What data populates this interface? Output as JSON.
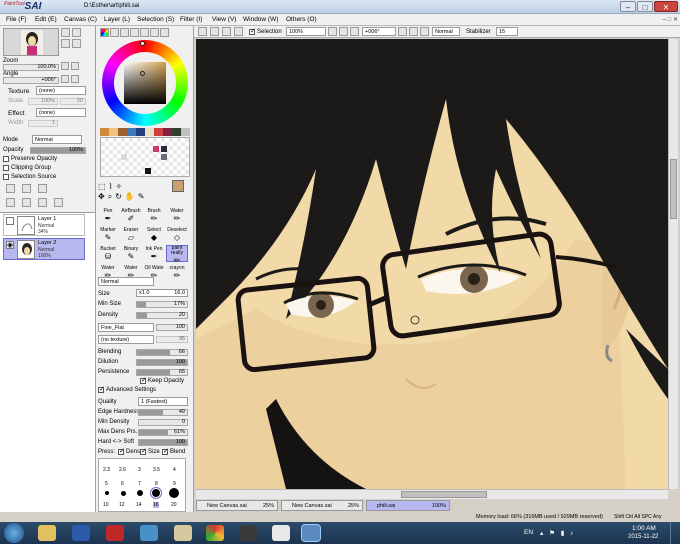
{
  "app": {
    "logo_main": "SAI",
    "logo_small": "PaintTool",
    "document_title": "D:\\Esther\\art\\phili.sai"
  },
  "menu": [
    {
      "label": "File (F)"
    },
    {
      "label": "Edit (E)"
    },
    {
      "label": "Canvas (C)"
    },
    {
      "label": "Layer (L)"
    },
    {
      "label": "Selection (S)"
    },
    {
      "label": "Filter (I)"
    },
    {
      "label": "View (V)"
    },
    {
      "label": "Window (W)"
    },
    {
      "label": "Others (O)"
    }
  ],
  "navigator": {
    "zoom_label": "Zoom",
    "zoom_value": "100.0%",
    "angle_label": "Angle",
    "angle_value": "+006°"
  },
  "paper": {
    "texture_label": "Texture",
    "texture_value": "(none)",
    "scale_label": "Scale",
    "scale_value": "100%",
    "strength_value": "20",
    "effect_label": "Effect",
    "effect_value": "(none)",
    "width_label": "Width",
    "width_value": "1"
  },
  "layer_props": {
    "mode_label": "Mode",
    "mode_value": "Normal",
    "opacity_label": "Opacity",
    "opacity_value": "100%",
    "opacity_fraction": 1.0,
    "preserve_opacity": "Preserve Opacity",
    "clipping_group": "Clipping Group",
    "selection_source": "Selection Source"
  },
  "layers": [
    {
      "name": "Layer 1",
      "mode": "Normal",
      "opacity": "34%",
      "selected": false
    },
    {
      "name": "Layer 2",
      "mode": "Normal",
      "opacity": "100%",
      "selected": true
    }
  ],
  "brushes": [
    {
      "label": "Pen"
    },
    {
      "label": "AirBrush"
    },
    {
      "label": "Brush"
    },
    {
      "label": "Water"
    },
    {
      "label": "Marker"
    },
    {
      "label": "Eraser"
    },
    {
      "label": "Select"
    },
    {
      "label": "Deselect"
    },
    {
      "label": "Bucket"
    },
    {
      "label": "Binary"
    },
    {
      "label": "Ink Pen"
    },
    {
      "label": "paint really"
    },
    {
      "label": "Water"
    },
    {
      "label": "Water"
    },
    {
      "label": "Oil Wate"
    },
    {
      "label": "crayon"
    }
  ],
  "brush_settings": {
    "mode_value": "Normal",
    "size_label": "Size",
    "size_mult": "x1.0",
    "size_value": "16.0",
    "size_fraction": 0.16,
    "min_size_label": "Min Size",
    "min_size_value": "17%",
    "min_size_fraction": 0.17,
    "density_label": "Density",
    "density_value": "20",
    "density_fraction": 0.2,
    "shape_value": "Fine_Flat",
    "shape_amount": "100",
    "texture_value": "(no texture)",
    "texture_amount": "95",
    "blending_label": "Blending",
    "blending_value": "66",
    "blending_fraction": 0.66,
    "dilution_label": "Dilution",
    "dilution_value": "100",
    "dilution_fraction": 1.0,
    "persistence_label": "Persistence",
    "persistence_value": "65",
    "persistence_fraction": 0.65,
    "keep_opacity": "Keep Opacity",
    "advanced_settings": "Advanced Settings",
    "quality_label": "Quality",
    "quality_value": "1 (Fastest)",
    "edge_hardness_label": "Edge Hardness",
    "edge_hardness_value": "49",
    "edge_hardness_fraction": 0.49,
    "min_density_label": "Min Density",
    "min_density_value": "0",
    "min_density_fraction": 0,
    "max_dens_prs_label": "Max Dens Prs.",
    "max_dens_prs_value": "61%",
    "max_dens_prs_fraction": 0.61,
    "hard_soft_label": "Hard <-> Soft",
    "hard_soft_value": "100",
    "hard_soft_fraction": 1.0,
    "press_label": "Press:",
    "press_dens": "Dens",
    "press_size": "Size",
    "press_blend": "Blend"
  },
  "brush_sizes_row1": [
    "2.3",
    "2.6",
    "3",
    "3.5",
    "4"
  ],
  "brush_sizes_row2": [
    "5",
    "6",
    "7",
    "8",
    "9"
  ],
  "brush_sizes_row3": [
    "10",
    "12",
    "14",
    "16",
    "20"
  ],
  "canvas_toolbar": {
    "selection_label": "Selection",
    "zoom_value": "100%",
    "angle_value": "+006°",
    "mode_value": "Normal",
    "stabilizer_label": "Stabilizer",
    "stabilizer_value": "15"
  },
  "tabs": [
    {
      "name": "New Canvas.sai",
      "zoom": "25%",
      "selected": false
    },
    {
      "name": "New Canvas.sai",
      "zoom": "25%",
      "selected": false
    },
    {
      "name": "phili.sai",
      "zoom": "100%",
      "selected": true
    }
  ],
  "status": {
    "memory": "Memory load: 66% (316MB used / 929MB reserved)",
    "keys": "Shift Ctrl Alt SPC Any"
  },
  "taskbar": {
    "lang": "EN",
    "time": "1:00 AM",
    "date": "2015-11-22"
  },
  "colors": {
    "accent_selected": "#b8b8f0",
    "skin": "#f2d9a8",
    "hair": "#1c1a18"
  }
}
